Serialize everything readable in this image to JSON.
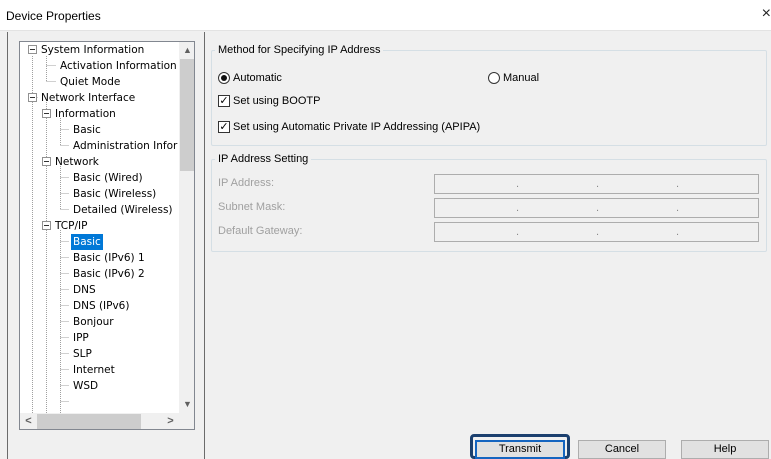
{
  "window": {
    "title": "Device Properties",
    "close_glyph": "×"
  },
  "tree": {
    "items": [
      {
        "label": "System Information"
      },
      {
        "label": "Activation Information"
      },
      {
        "label": "Quiet Mode"
      },
      {
        "label": "Network Interface"
      },
      {
        "label": "Information"
      },
      {
        "label": "Basic"
      },
      {
        "label": "Administration Infor"
      },
      {
        "label": "Network"
      },
      {
        "label": "Basic (Wired)"
      },
      {
        "label": "Basic (Wireless)"
      },
      {
        "label": "Detailed (Wireless)"
      },
      {
        "label": "TCP/IP"
      },
      {
        "label": "Basic",
        "selected": true
      },
      {
        "label": "Basic (IPv6) 1"
      },
      {
        "label": "Basic (IPv6) 2"
      },
      {
        "label": "DNS"
      },
      {
        "label": "DNS (IPv6)"
      },
      {
        "label": "Bonjour"
      },
      {
        "label": "IPP"
      },
      {
        "label": "SLP"
      },
      {
        "label": "Internet"
      },
      {
        "label": "WSD"
      }
    ],
    "scroll_up": "▲",
    "scroll_down": "▼",
    "scroll_left": "<",
    "scroll_right": ">"
  },
  "method_group": {
    "title": "Method for Specifying IP Address",
    "automatic_label": "Automatic",
    "automatic_selected": true,
    "manual_label": "Manual",
    "manual_selected": false,
    "bootp_label": "Set using BOOTP",
    "bootp_checked": true,
    "apipa_label": "Set using Automatic Private IP Addressing (APIPA)",
    "apipa_checked": true
  },
  "ip_group": {
    "title": "IP Address Setting",
    "ip_address_label": "IP Address:",
    "subnet_mask_label": "Subnet Mask:",
    "default_gateway_label": "Default Gateway:",
    "separator": "."
  },
  "buttons": {
    "transmit": "Transmit",
    "cancel": "Cancel",
    "help": "Help"
  },
  "colors": {
    "selection": "#0078d7",
    "focus_ring": "#1b3f6e"
  }
}
